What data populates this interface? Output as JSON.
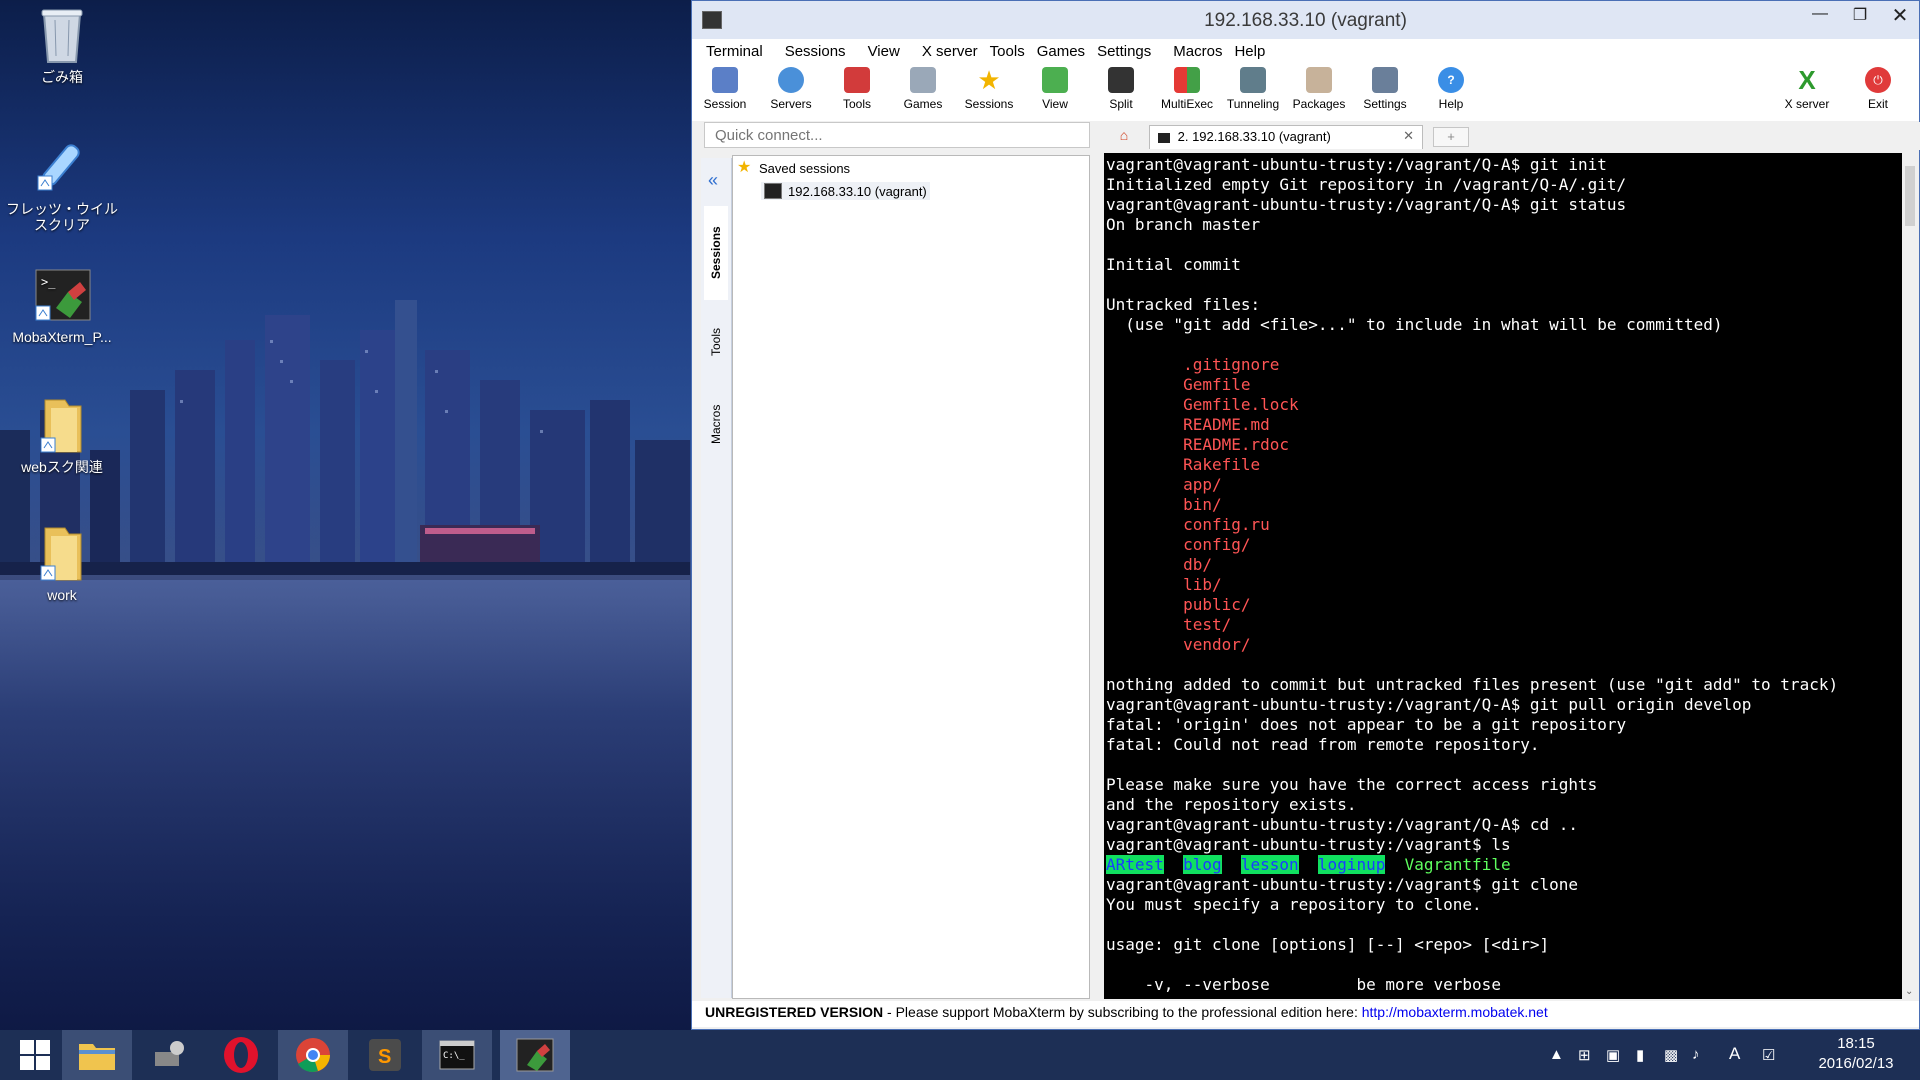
{
  "desktop": {
    "icons": [
      {
        "label": "ごみ箱",
        "icon": "trash-icon"
      },
      {
        "label": "フレッツ・ウイルスクリア",
        "icon": "shield-syringe-icon"
      },
      {
        "label": "MobaXterm_P...",
        "icon": "terminal-shortcut-icon"
      },
      {
        "label": "webスク関連",
        "icon": "folder-icon"
      },
      {
        "label": "work",
        "icon": "folder-icon"
      }
    ]
  },
  "window": {
    "title": "192.168.33.10 (vagrant)",
    "menu": [
      "Terminal",
      "Sessions",
      "View",
      "X server",
      "Tools",
      "Games",
      "Settings",
      "Macros",
      "Help"
    ],
    "toolbar": [
      "Session",
      "Servers",
      "Tools",
      "Games",
      "Sessions",
      "View",
      "Split",
      "MultiExec",
      "Tunneling",
      "Packages",
      "Settings",
      "Help"
    ],
    "xserver_label": "X server",
    "exit_label": "Exit",
    "quick_connect_placeholder": "Quick connect...",
    "sidetabs": [
      "Sessions",
      "Tools",
      "Macros"
    ],
    "saved_sessions_label": "Saved sessions",
    "session_item": "192.168.33.10 (vagrant)",
    "tab_label": "2. 192.168.33.10 (vagrant)",
    "status": {
      "bold": "UNREGISTERED VERSION",
      "text": " -  Please support MobaXterm by subscribing to the professional edition here:  ",
      "link": "http://mobaxterm.mobatek.net"
    }
  },
  "terminal": {
    "lines": [
      {
        "t": "vagrant@vagrant-ubuntu-trusty:/vagrant/Q-A$ git init"
      },
      {
        "t": "Initialized empty Git repository in /vagrant/Q-A/.git/"
      },
      {
        "t": "vagrant@vagrant-ubuntu-trusty:/vagrant/Q-A$ git status"
      },
      {
        "t": "On branch master"
      },
      {
        "t": ""
      },
      {
        "t": "Initial commit"
      },
      {
        "t": ""
      },
      {
        "t": "Untracked files:"
      },
      {
        "t": "  (use \"git add <file>...\" to include in what will be committed)"
      },
      {
        "t": ""
      },
      {
        "t": "        .gitignore",
        "c": "red"
      },
      {
        "t": "        Gemfile",
        "c": "red"
      },
      {
        "t": "        Gemfile.lock",
        "c": "red"
      },
      {
        "t": "        README.md",
        "c": "red"
      },
      {
        "t": "        README.rdoc",
        "c": "red"
      },
      {
        "t": "        Rakefile",
        "c": "red"
      },
      {
        "t": "        app/",
        "c": "red"
      },
      {
        "t": "        bin/",
        "c": "red"
      },
      {
        "t": "        config.ru",
        "c": "red"
      },
      {
        "t": "        config/",
        "c": "red"
      },
      {
        "t": "        db/",
        "c": "red"
      },
      {
        "t": "        lib/",
        "c": "red"
      },
      {
        "t": "        public/",
        "c": "red"
      },
      {
        "t": "        test/",
        "c": "red"
      },
      {
        "t": "        vendor/",
        "c": "red"
      },
      {
        "t": ""
      },
      {
        "t": "nothing added to commit but untracked files present (use \"git add\" to track)"
      },
      {
        "t": "vagrant@vagrant-ubuntu-trusty:/vagrant/Q-A$ git pull origin develop"
      },
      {
        "t": "fatal: 'origin' does not appear to be a git repository"
      },
      {
        "t": "fatal: Could not read from remote repository."
      },
      {
        "t": ""
      },
      {
        "t": "Please make sure you have the correct access rights"
      },
      {
        "t": "and the repository exists."
      },
      {
        "t": "vagrant@vagrant-ubuntu-trusty:/vagrant/Q-A$ cd .."
      },
      {
        "t": "vagrant@vagrant-ubuntu-trusty:/vagrant$ ls"
      },
      {
        "ls": [
          "ARtest",
          "blog",
          "lesson",
          "loginup"
        ],
        "plain": "Vagrantfile"
      },
      {
        "t": "vagrant@vagrant-ubuntu-trusty:/vagrant$ git clone"
      },
      {
        "t": "You must specify a repository to clone."
      },
      {
        "t": ""
      },
      {
        "t": "usage: git clone [options] [--] <repo> [<dir>]"
      },
      {
        "t": ""
      },
      {
        "t": "    -v, --verbose         be more verbose"
      }
    ]
  },
  "taskbar": {
    "apps": [
      "start-icon",
      "file-explorer-icon",
      "network-tool-icon",
      "opera-icon",
      "chrome-icon",
      "sublime-text-icon",
      "command-prompt-icon",
      "mobaxterm-icon"
    ],
    "tray_ime": "A",
    "time": "18:15",
    "date": "2016/02/13"
  }
}
